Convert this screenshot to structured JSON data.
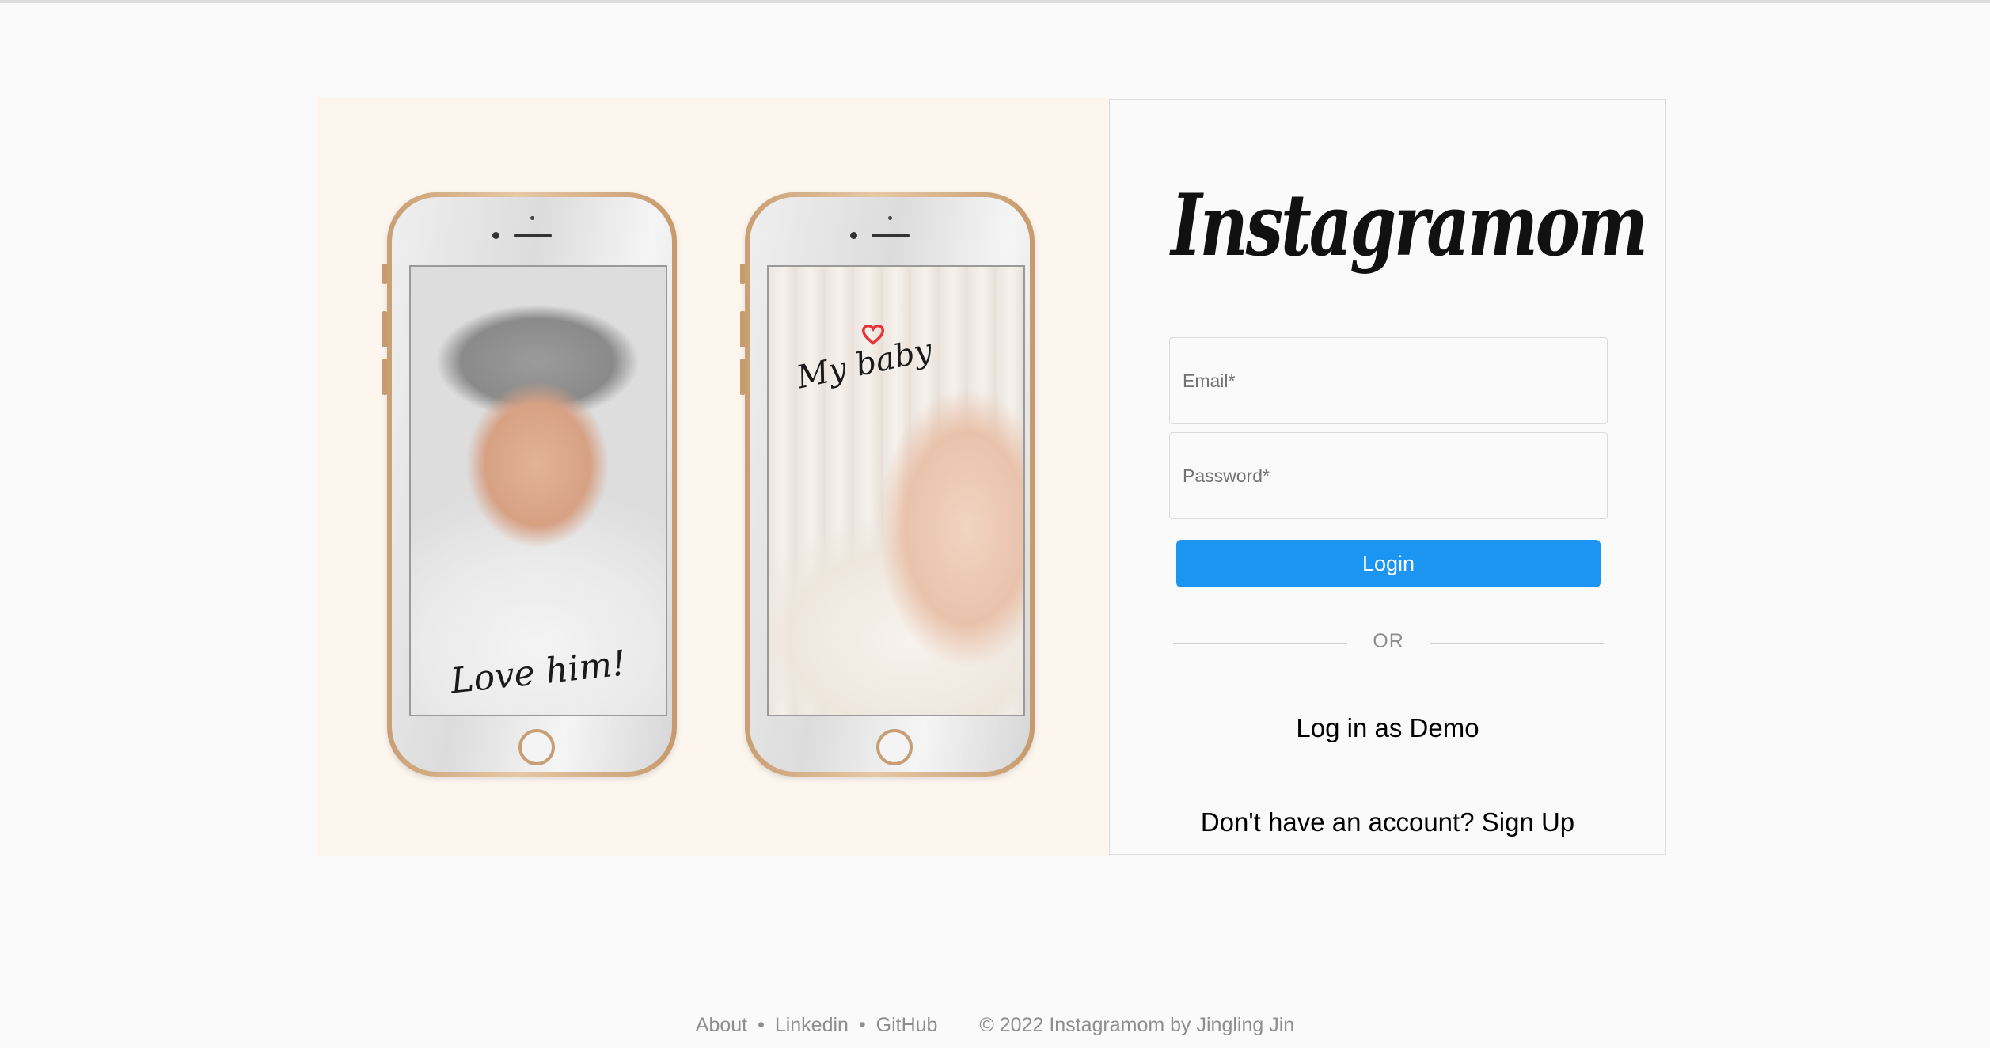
{
  "brand": {
    "logo_text": "Instagramom"
  },
  "hero": {
    "phone_1_caption": "Love him!",
    "phone_2_caption": "My baby",
    "heart_color": "#e8323c"
  },
  "login": {
    "email_placeholder": "Email*",
    "password_placeholder": "Password*",
    "submit_label": "Login",
    "divider_text": "OR",
    "demo_label": "Log in as Demo",
    "signup_prompt": "Don't have an account?",
    "signup_label": "Sign Up",
    "accent_color": "#1b95f1"
  },
  "footer": {
    "links": [
      "About",
      "Linkedin",
      "GitHub"
    ],
    "separator": "•",
    "copyright": "© 2022 Instagramom by Jingling Jin"
  }
}
